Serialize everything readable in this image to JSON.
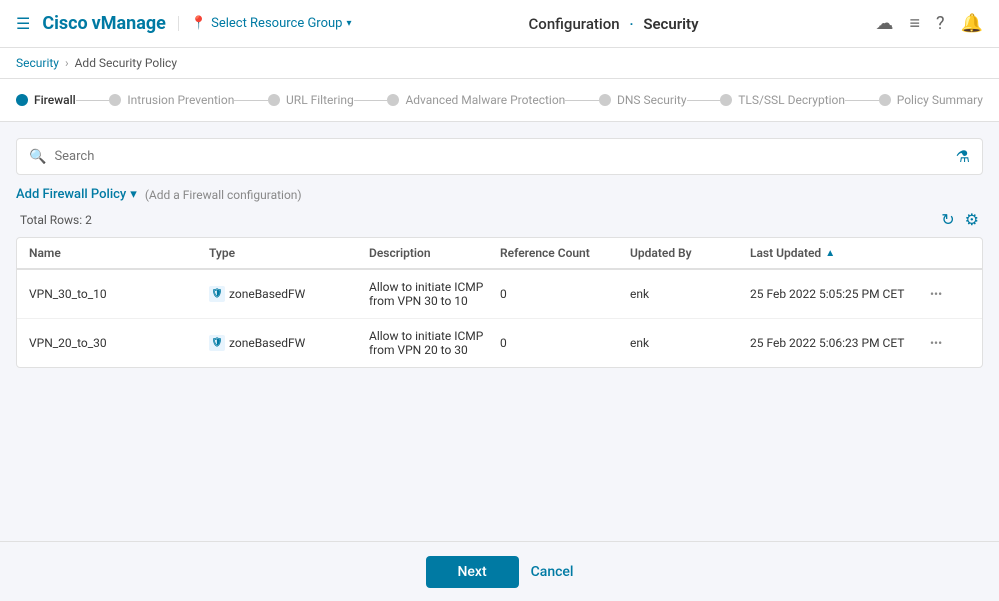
{
  "header": {
    "brand": "Cisco vManage",
    "cisco_label": "Cisco",
    "vmanage_label": "vManage",
    "resource_group_label": "Select Resource Group",
    "page_title": "Configuration",
    "page_section": "Security",
    "title_dot": "·"
  },
  "nav_icons": {
    "hamburger": "☰",
    "cloud": "☁",
    "list": "≡",
    "question": "?",
    "bell": "🔔"
  },
  "breadcrumb": {
    "parent": "Security",
    "separator": "›",
    "current": "Add Security Policy"
  },
  "wizard": {
    "steps": [
      {
        "id": "firewall",
        "label": "Firewall",
        "active": true
      },
      {
        "id": "intrusion",
        "label": "Intrusion Prevention",
        "active": false
      },
      {
        "id": "url",
        "label": "URL Filtering",
        "active": false
      },
      {
        "id": "malware",
        "label": "Advanced Malware Protection",
        "active": false
      },
      {
        "id": "dns",
        "label": "DNS Security",
        "active": false
      },
      {
        "id": "tls",
        "label": "TLS/SSL Decryption",
        "active": false
      },
      {
        "id": "summary",
        "label": "Policy Summary",
        "active": false
      }
    ]
  },
  "search": {
    "placeholder": "Search"
  },
  "add_policy": {
    "label": "Add Firewall Policy",
    "hint": "(Add a Firewall configuration)"
  },
  "table": {
    "total_rows_label": "Total Rows: 2",
    "columns": [
      {
        "id": "name",
        "label": "Name"
      },
      {
        "id": "type",
        "label": "Type"
      },
      {
        "id": "description",
        "label": "Description"
      },
      {
        "id": "ref_count",
        "label": "Reference Count"
      },
      {
        "id": "updated_by",
        "label": "Updated By"
      },
      {
        "id": "last_updated",
        "label": "Last Updated"
      },
      {
        "id": "actions",
        "label": ""
      }
    ],
    "rows": [
      {
        "name": "VPN_30_to_10",
        "type": "zoneBasedFW",
        "description": "Allow to initiate ICMP from VPN 30 to 10",
        "ref_count": "0",
        "updated_by": "enk",
        "last_updated": "25 Feb 2022 5:05:25 PM CET"
      },
      {
        "name": "VPN_20_to_30",
        "type": "zoneBasedFW",
        "description": "Allow to initiate ICMP from VPN 20 to 30",
        "ref_count": "0",
        "updated_by": "enk",
        "last_updated": "25 Feb 2022 5:06:23 PM CET"
      }
    ]
  },
  "buttons": {
    "next": "Next",
    "cancel": "Cancel"
  }
}
